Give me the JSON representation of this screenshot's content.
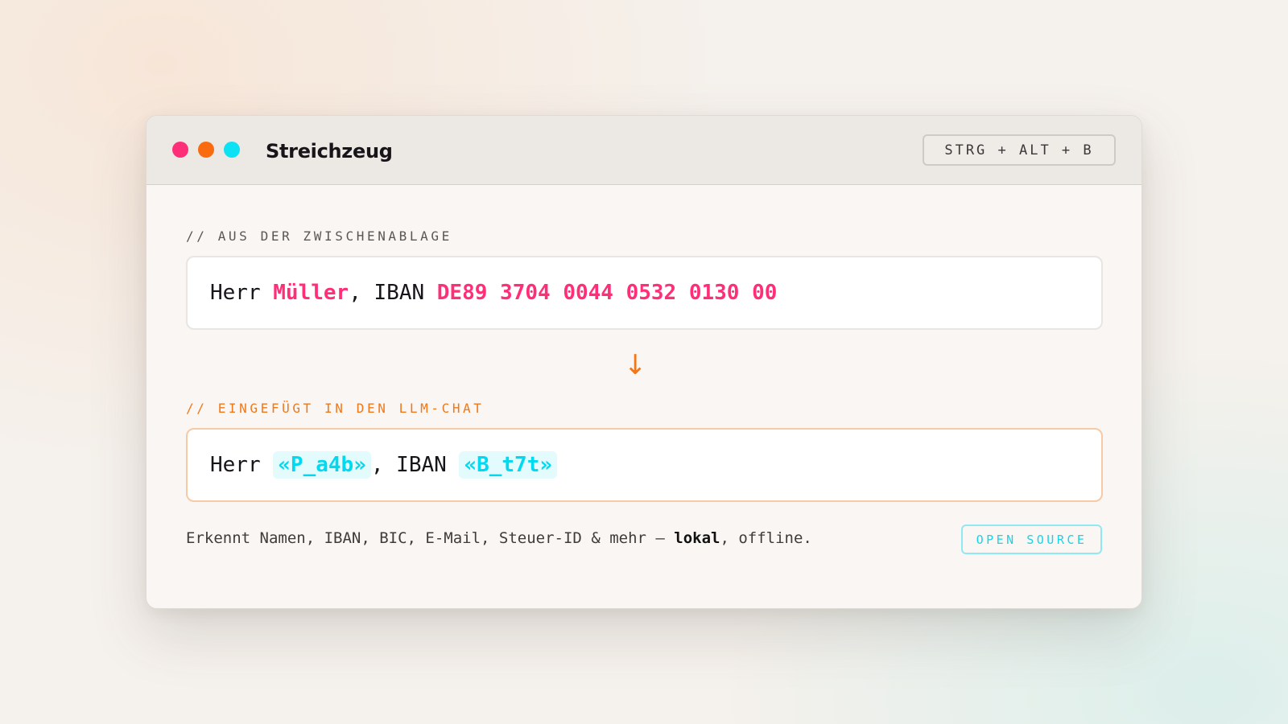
{
  "window": {
    "title": "Streichzeug",
    "shortcut": "STRG + ALT + B",
    "traffic_lights": {
      "red": "#ff2e79",
      "orange": "#fa6b0f",
      "cyan": "#0de1f4"
    }
  },
  "source": {
    "label": "// AUS DER ZWISCHENABLAGE",
    "prefix": "Herr ",
    "name": "Müller",
    "middle": ", IBAN ",
    "iban": "DE89 3704 0044 0532 0130 00"
  },
  "arrow_icon": "arrow-down-icon",
  "arrow_glyph": "↓",
  "target": {
    "label": "// EINGEFÜGT IN DEN LLM-CHAT",
    "prefix": "Herr ",
    "name_token": "«P_a4b»",
    "middle": ", IBAN ",
    "iban_token": "«B_t7t»"
  },
  "footer": {
    "text_before": "Erkennt Namen, IBAN, BIC, E-Mail, Steuer-ID & mehr — ",
    "bold": "lokal",
    "text_after": ", offline.",
    "badge": "OPEN SOURCE"
  },
  "colors": {
    "accent_pink": "#ff2e79",
    "accent_orange": "#f0781a",
    "accent_cyan": "#00d9ef"
  }
}
